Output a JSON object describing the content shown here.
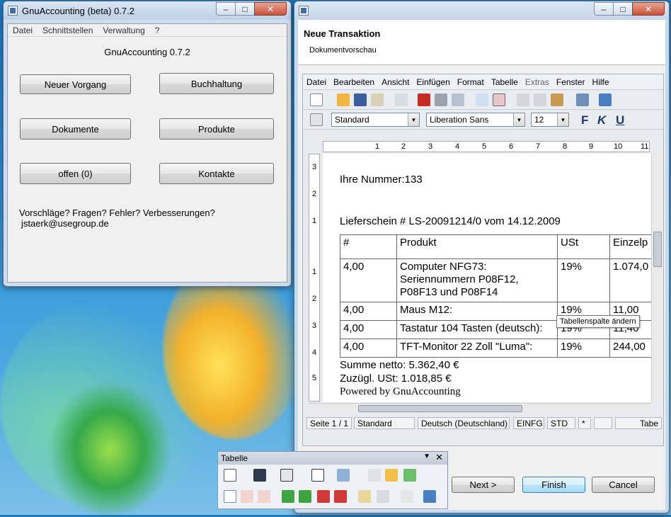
{
  "desktop": {
    "wallpaper": "windows-7-blue"
  },
  "gnu_window": {
    "title": "GnuAccounting (beta) 0.7.2",
    "caption": {
      "min": "–",
      "max": "□",
      "close": "✕"
    },
    "menu": [
      "Datei",
      "Schnittstellen",
      "Verwaltung",
      "?"
    ],
    "heading": "GnuAccounting 0.7.2",
    "buttons": {
      "neuer_vorgang": "Neuer Vorgang",
      "buchhaltung": "Buchhaltung",
      "dokumente": "Dokumente",
      "produkte": "Produkte",
      "offen": "offen (0)",
      "kontakte": "Kontakte"
    },
    "feedback_text": "Vorschläge? Fragen? Fehler? Verbesserungen?",
    "email": "jstaerk@usegroup.de"
  },
  "wizard_window": {
    "caption": {
      "min": "–",
      "max": "□",
      "close": "✕"
    },
    "title": "Neue Transaktion",
    "subtitle": "Dokumentvorschau",
    "writer_menu": [
      "Datei",
      "Bearbeiten",
      "Ansicht",
      "Einfügen",
      "Format",
      "Tabelle",
      "Extras",
      "Fenster",
      "Hilfe"
    ],
    "paragraph_style": "Standard",
    "font_name": "Liberation Sans",
    "font_size": "12",
    "format_buttons": {
      "bold": "F",
      "italic": "K",
      "underline": "U"
    },
    "ruler_numbers": [
      "1",
      "2",
      "3",
      "4",
      "5",
      "6",
      "7",
      "8",
      "9",
      "10",
      "11"
    ],
    "vertical_ruler_numbers": [
      "3",
      "2",
      "1",
      "1",
      "2",
      "3",
      "4",
      "5"
    ],
    "document": {
      "line1": "Ihre Nummer:133",
      "line2": "Lieferschein # LS-20091214/0 vom 14.12.2009",
      "table_headers": [
        "#",
        "Produkt",
        "USt",
        "Einzelp"
      ],
      "rows": [
        {
          "qty": "4,00",
          "product": "Computer NFG73: Seriennummern P08F12, P08F13 und P08F14",
          "product_lines": [
            "Computer NFG73:",
            "Seriennummern P08F12,",
            "P08F13 und P08F14"
          ],
          "vat": "19%",
          "price": "1.074,0"
        },
        {
          "qty": "4,00",
          "product": "Maus M12:",
          "vat": "19%",
          "price": "11,00"
        },
        {
          "qty": "4,00",
          "product": "Tastatur 104 Tasten (deutsch):",
          "vat": "19%",
          "price": "11,40"
        },
        {
          "qty": "4,00",
          "product": "TFT-Monitor 22 Zoll \"Luma\":",
          "vat": "19%",
          "price": "244,00"
        }
      ],
      "summe": "Summe netto: 5.362,40 €",
      "zuzugl": "Zuzügl. USt: 1.018,85 €",
      "powered": "Powered by GnuAccounting"
    },
    "tooltip": "Tabellenspalte ändern",
    "status": {
      "page": "Seite 1 / 1",
      "style": "Standard",
      "language": "Deutsch (Deutschland)",
      "insert": "EINFG",
      "std": "STD",
      "modified": "*",
      "table": "Tabe"
    },
    "buttons": {
      "next": "Next >",
      "finish": "Finish",
      "cancel": "Cancel"
    }
  },
  "table_toolbar": {
    "title": "Tabelle"
  }
}
